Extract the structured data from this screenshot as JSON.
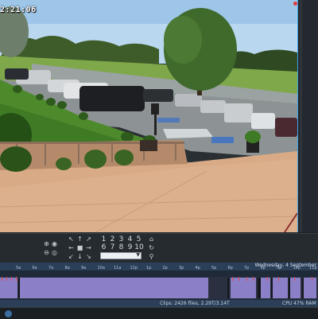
{
  "viewer": {
    "timestamp": "2:21:06"
  },
  "controls": {
    "zoom_in_label": "⊕",
    "zoom_out_label": "⊖",
    "eye_label": "◉",
    "ring_label": "◎",
    "arrows": [
      "↖",
      "↑",
      "↗",
      "←",
      "■",
      "→",
      "↙",
      "↓",
      "↘"
    ],
    "presets_row1": [
      "1",
      "2",
      "3",
      "4",
      "5"
    ],
    "presets_row2": [
      "6",
      "7",
      "8",
      "9",
      "10"
    ],
    "home_label": "⌂",
    "refresh_label": "↻",
    "pin_label": "⚲"
  },
  "timeline": {
    "date": "Wednesday, 4 September",
    "hours": [
      "5a",
      "6a",
      "7a",
      "8a",
      "9a",
      "10a",
      "11a",
      "12p",
      "1p",
      "2p",
      "3p",
      "4p",
      "5p",
      "6p",
      "7p",
      "8p",
      "9p",
      "10p",
      "11p"
    ]
  },
  "status": {
    "clips": "Clips: 2426 files, 2.29T/3.14T",
    "cpu": "CPU 47% RAM"
  },
  "colors": {
    "accent": "#3fa0e0",
    "recording_fill": "#8b80c8",
    "motion_marker": "#d94848"
  }
}
